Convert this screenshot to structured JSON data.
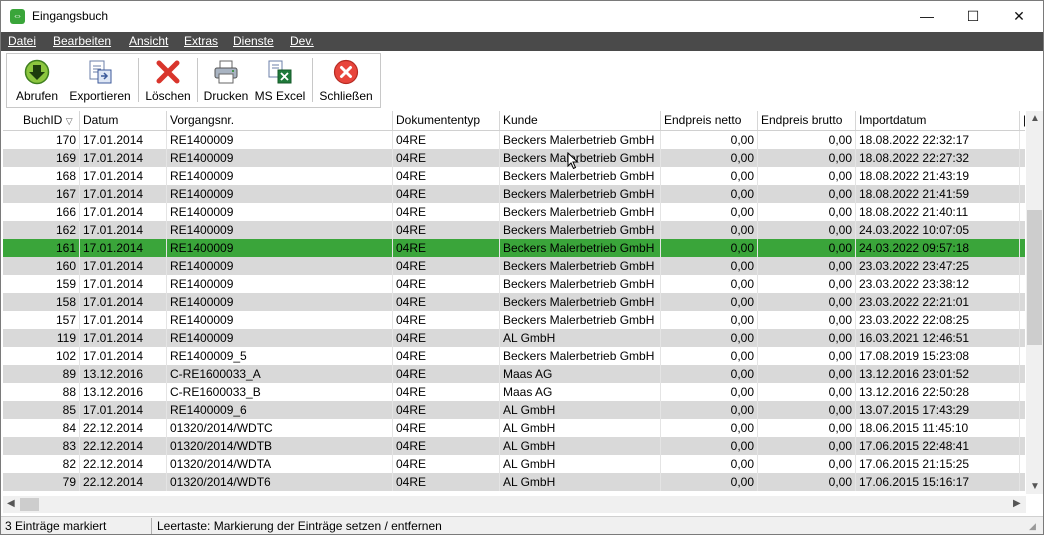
{
  "window": {
    "title": "Eingangsbuch",
    "minimize": "—",
    "maximize": "☐",
    "close": "✕"
  },
  "menu": [
    "Datei",
    "Bearbeiten",
    "Ansicht",
    "Extras",
    "Dienste",
    "Dev."
  ],
  "toolbar": {
    "abrufen": "Abrufen",
    "exportieren": "Exportieren",
    "loeschen": "Löschen",
    "drucken": "Drucken",
    "msexcel": "MS Excel",
    "schliessen": "Schließen"
  },
  "table": {
    "columns": [
      "BuchID",
      "Datum",
      "Vorgangsnr.",
      "Dokumententyp",
      "Kunde",
      "Endpreis netto",
      "Endpreis brutto",
      "Importdatum"
    ],
    "sort_indicator": "▽",
    "rows": [
      [
        "170",
        "17.01.2014",
        "RE1400009",
        "04RE",
        "Beckers Malerbetrieb GmbH",
        "0,00",
        "0,00",
        "18.08.2022 22:32:17"
      ],
      [
        "169",
        "17.01.2014",
        "RE1400009",
        "04RE",
        "Beckers Malerbetrieb GmbH",
        "0,00",
        "0,00",
        "18.08.2022 22:27:32"
      ],
      [
        "168",
        "17.01.2014",
        "RE1400009",
        "04RE",
        "Beckers Malerbetrieb GmbH",
        "0,00",
        "0,00",
        "18.08.2022 21:43:19"
      ],
      [
        "167",
        "17.01.2014",
        "RE1400009",
        "04RE",
        "Beckers Malerbetrieb GmbH",
        "0,00",
        "0,00",
        "18.08.2022 21:41:59"
      ],
      [
        "166",
        "17.01.2014",
        "RE1400009",
        "04RE",
        "Beckers Malerbetrieb GmbH",
        "0,00",
        "0,00",
        "18.08.2022 21:40:11"
      ],
      [
        "162",
        "17.01.2014",
        "RE1400009",
        "04RE",
        "Beckers Malerbetrieb GmbH",
        "0,00",
        "0,00",
        "24.03.2022 10:07:05"
      ],
      [
        "161",
        "17.01.2014",
        "RE1400009",
        "04RE",
        "Beckers Malerbetrieb GmbH",
        "0,00",
        "0,00",
        "24.03.2022 09:57:18"
      ],
      [
        "160",
        "17.01.2014",
        "RE1400009",
        "04RE",
        "Beckers Malerbetrieb GmbH",
        "0,00",
        "0,00",
        "23.03.2022 23:47:25"
      ],
      [
        "159",
        "17.01.2014",
        "RE1400009",
        "04RE",
        "Beckers Malerbetrieb GmbH",
        "0,00",
        "0,00",
        "23.03.2022 23:38:12"
      ],
      [
        "158",
        "17.01.2014",
        "RE1400009",
        "04RE",
        "Beckers Malerbetrieb GmbH",
        "0,00",
        "0,00",
        "23.03.2022 22:21:01"
      ],
      [
        "157",
        "17.01.2014",
        "RE1400009",
        "04RE",
        "Beckers Malerbetrieb GmbH",
        "0,00",
        "0,00",
        "23.03.2022 22:08:25"
      ],
      [
        "119",
        "17.01.2014",
        "RE1400009",
        "04RE",
        "AL GmbH",
        "0,00",
        "0,00",
        "16.03.2021 12:46:51"
      ],
      [
        "102",
        "17.01.2014",
        "RE1400009_5",
        "04RE",
        "Beckers Malerbetrieb GmbH",
        "0,00",
        "0,00",
        "17.08.2019 15:23:08"
      ],
      [
        "89",
        "13.12.2016",
        "C-RE1600033_A",
        "04RE",
        "Maas AG",
        "0,00",
        "0,00",
        "13.12.2016 23:01:52"
      ],
      [
        "88",
        "13.12.2016",
        "C-RE1600033_B",
        "04RE",
        "Maas AG",
        "0,00",
        "0,00",
        "13.12.2016 22:50:28"
      ],
      [
        "85",
        "17.01.2014",
        "RE1400009_6",
        "04RE",
        "AL GmbH",
        "0,00",
        "0,00",
        "13.07.2015 17:43:29"
      ],
      [
        "84",
        "22.12.2014",
        "01320/2014/WDTC",
        "04RE",
        "AL GmbH",
        "0,00",
        "0,00",
        "18.06.2015 11:45:10"
      ],
      [
        "83",
        "22.12.2014",
        "01320/2014/WDTB",
        "04RE",
        "AL GmbH",
        "0,00",
        "0,00",
        "17.06.2015 22:48:41"
      ],
      [
        "82",
        "22.12.2014",
        "01320/2014/WDTA",
        "04RE",
        "AL GmbH",
        "0,00",
        "0,00",
        "17.06.2015 21:15:25"
      ],
      [
        "79",
        "22.12.2014",
        "01320/2014/WDT6",
        "04RE",
        "AL GmbH",
        "0,00",
        "0,00",
        "17.06.2015 15:16:17"
      ]
    ],
    "selected_row": 6
  },
  "status": {
    "left": "3 Einträge markiert",
    "right": "Leertaste: Markierung der Einträge setzen / entfernen"
  },
  "colors": {
    "menubar": "#4a4a4a",
    "selection": "#3aa53a",
    "alt_row": "#d9d9d9"
  }
}
